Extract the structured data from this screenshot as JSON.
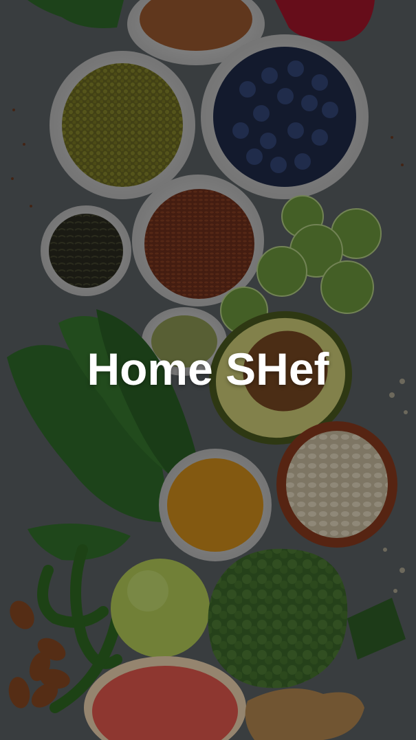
{
  "splash": {
    "title": "Home SHef",
    "background": "vegetables-and-ingredients-photo"
  },
  "colors": {
    "background": "#2a2d31",
    "title_text": "#ffffff"
  }
}
